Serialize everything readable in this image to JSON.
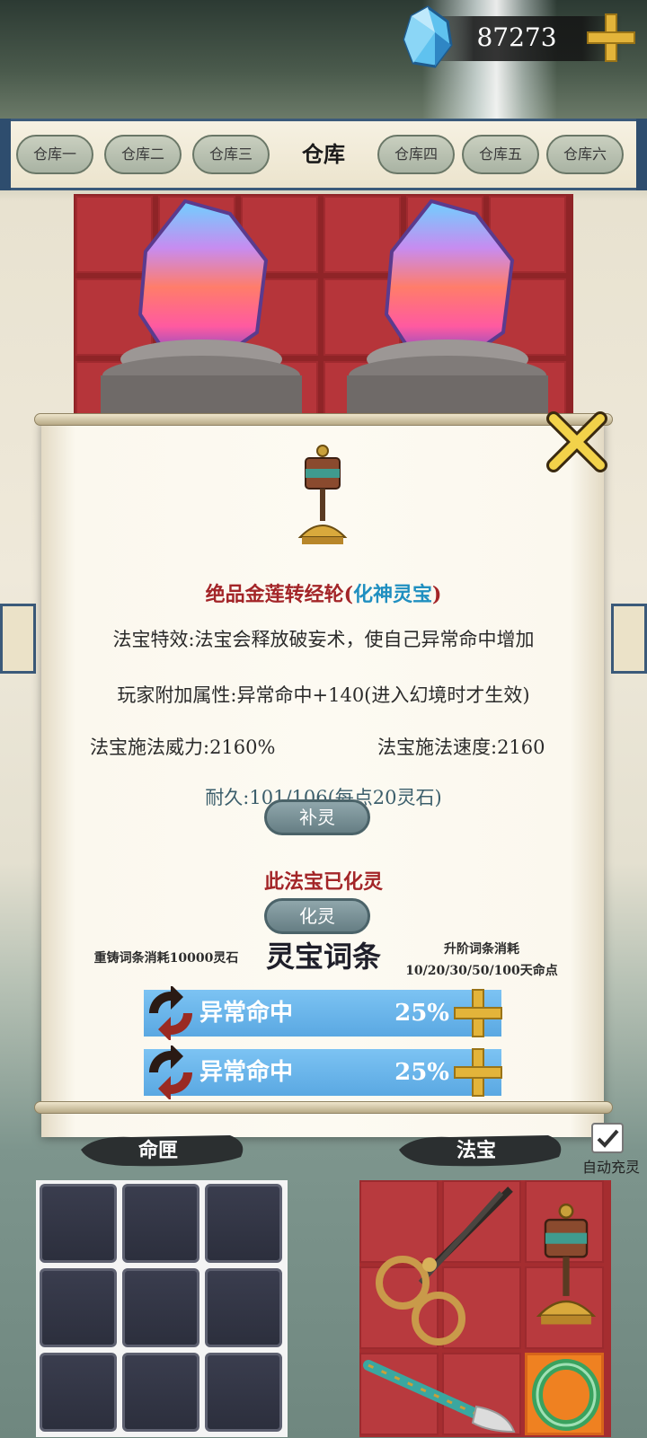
{
  "currency": {
    "value": "87273",
    "icon": "blue-gem-icon"
  },
  "tabs": {
    "items": [
      "仓库一",
      "仓库二",
      "仓库三",
      "仓库四",
      "仓库五",
      "仓库六"
    ],
    "active_title": "仓库"
  },
  "item": {
    "name": "绝品金莲转经轮",
    "grade_open": "(",
    "grade": "化神灵宝",
    "grade_close": ")",
    "effect": "法宝特效:法宝会释放破妄术，使自己异常命中增加",
    "player_bonus": "玩家附加属性:异常命中+140(进入幻境时才生效)",
    "cast_power": "法宝施法威力:2160%",
    "cast_speed": "法宝施法速度:2160",
    "durability": "耐久:101/106(每点20灵石)",
    "replenish_button": "补灵",
    "converted_status": "此法宝已化灵",
    "convert_button": "化灵"
  },
  "affixes": {
    "reforge_cost": "重铸词条消耗10000灵石",
    "title": "灵宝词条",
    "upgrade_cost_line1": "升阶词条消耗",
    "upgrade_cost_line2": "10/20/30/50/100天命点",
    "rows": [
      {
        "name": "异常命中",
        "value": "25%"
      },
      {
        "name": "异常命中",
        "value": "25%"
      }
    ]
  },
  "bottom": {
    "fate_label": "命匣",
    "treasure_label": "法宝",
    "auto_recharge_label": "自动充灵",
    "auto_recharge_checked": true
  },
  "colors": {
    "storage_red": "#b6353a",
    "item_name": "#a32528",
    "grade_blue": "#1f8fc0",
    "affix_bar": "#6bb7ea",
    "selected_slot": "#ef8121"
  }
}
